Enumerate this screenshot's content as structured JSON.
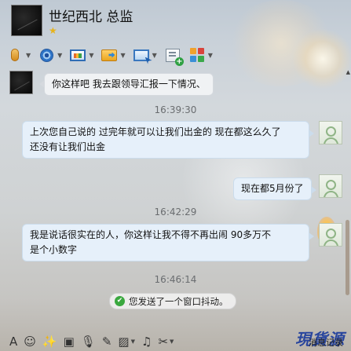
{
  "header": {
    "contact_name": "世纪西北 总监",
    "star": "★"
  },
  "toolbar": {
    "items": [
      {
        "name": "microphone-icon",
        "caret": "▼"
      },
      {
        "name": "webcam-icon",
        "caret": "▼"
      },
      {
        "name": "remote-desktop-icon",
        "caret": "▼"
      },
      {
        "name": "send-file-icon",
        "caret": "▼"
      },
      {
        "name": "screen-share-icon",
        "caret": "▼"
      },
      {
        "name": "create-group-icon",
        "caret": ""
      },
      {
        "name": "app-grid-icon",
        "caret": "▼"
      }
    ],
    "grid_colors": [
      "#f0a22c",
      "#d9443c",
      "#3a8fd6",
      "#3aa84a"
    ]
  },
  "chat": {
    "messages": [
      {
        "side": "left",
        "text": "你这样吧 我去跟领导汇报一下情况、"
      },
      {
        "side": "right",
        "time": "16:39:30",
        "line1": "上次您自己说的 过完年就可以让我们出金的  现在都这么久了",
        "line2": "还没有让我们出金"
      },
      {
        "side": "right",
        "text": "现在都5月份了"
      },
      {
        "side": "right",
        "time": "16:42:29",
        "line1": "我是说话很实在的人，你这样让我不得不再出闹   90多万不",
        "line2": "是个小数字"
      }
    ],
    "time3": "16:46:14",
    "notice": "您发送了一个窗口抖动。",
    "notice_check": "✔"
  },
  "input_toolbar": {
    "font_icon": "A",
    "emoji_icon": "☺",
    "shake_icon": "✨",
    "magic_icon": "▣",
    "voice_icon": "🎙",
    "edit_icon": "✎",
    "image_icon": "▨",
    "music_icon": "♫",
    "scissors_icon": "✂",
    "caret": "▼",
    "history_label": "消息记录"
  },
  "watermark": "現貨源"
}
